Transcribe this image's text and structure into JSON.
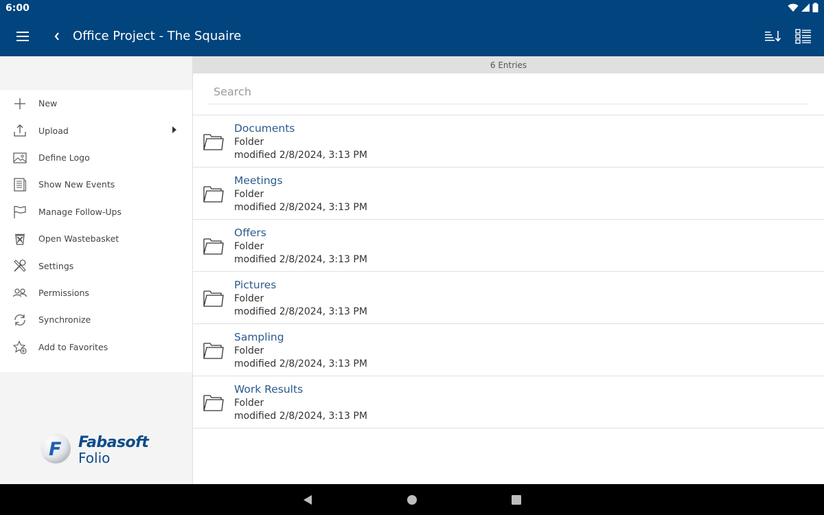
{
  "status_bar": {
    "time": "6:00"
  },
  "app_bar": {
    "title": "Office Project - The Squaire"
  },
  "sidebar": {
    "items": [
      {
        "label": "New",
        "icon": "plus-icon"
      },
      {
        "label": "Upload",
        "icon": "upload-icon",
        "has_submenu": true
      },
      {
        "label": "Define Logo",
        "icon": "image-icon"
      },
      {
        "label": "Show New Events",
        "icon": "events-list-icon"
      },
      {
        "label": "Manage Follow-Ups",
        "icon": "flag-icon"
      },
      {
        "label": "Open Wastebasket",
        "icon": "wastebasket-icon"
      },
      {
        "label": "Settings",
        "icon": "tools-icon"
      },
      {
        "label": "Permissions",
        "icon": "users-icon"
      },
      {
        "label": "Synchronize",
        "icon": "sync-icon"
      },
      {
        "label": "Add to Favorites",
        "icon": "star-add-icon"
      }
    ],
    "logo": {
      "brand": "Fabasoft",
      "product": "Folio"
    }
  },
  "main": {
    "entries_count": "6 Entries",
    "search": {
      "placeholder": "Search",
      "value": ""
    },
    "rows": [
      {
        "name": "Documents",
        "type": "Folder",
        "modified": "modified 2/8/2024, 3:13 PM"
      },
      {
        "name": "Meetings",
        "type": "Folder",
        "modified": "modified 2/8/2024, 3:13 PM"
      },
      {
        "name": "Offers",
        "type": "Folder",
        "modified": "modified 2/8/2024, 3:13 PM"
      },
      {
        "name": "Pictures",
        "type": "Folder",
        "modified": "modified 2/8/2024, 3:13 PM"
      },
      {
        "name": "Sampling",
        "type": "Folder",
        "modified": "modified 2/8/2024, 3:13 PM"
      },
      {
        "name": "Work Results",
        "type": "Folder",
        "modified": "modified 2/8/2024, 3:13 PM"
      }
    ]
  },
  "colors": {
    "app_bar": "#01447e",
    "link": "#2a5a8e",
    "sidebar_bg": "#f4f4f4",
    "nav_bar": "#000000"
  }
}
